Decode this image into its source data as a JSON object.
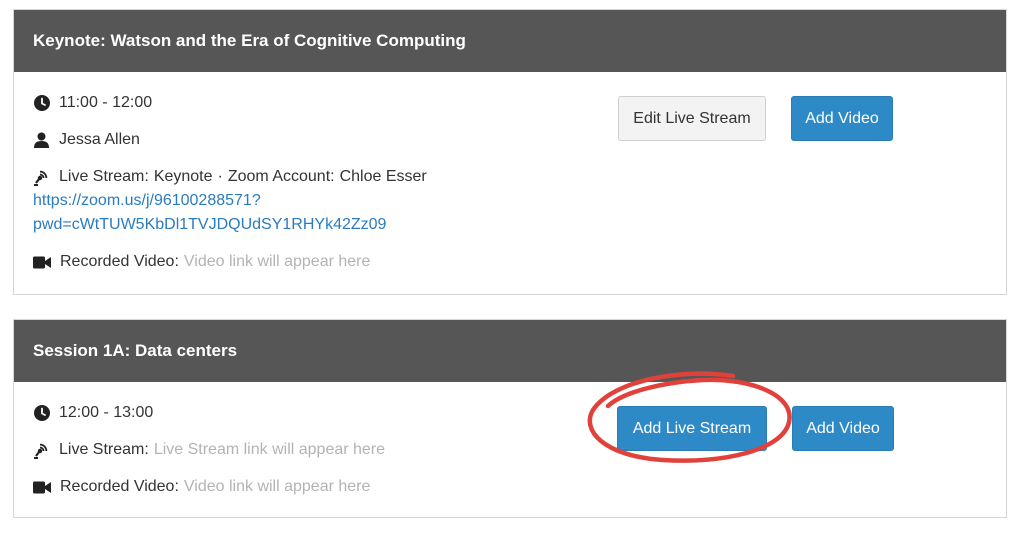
{
  "sessions": [
    {
      "title": "Keynote: Watson and the Era of Cognitive Computing",
      "time": "11:00 - 12:00",
      "speaker": "Jessa Allen",
      "live_stream_label": "Live Stream:",
      "live_stream_name": "Keynote",
      "separator": "·",
      "zoom_account_label": "Zoom Account:",
      "zoom_account_name": "Chloe Esser",
      "link_line1": "https://zoom.us/j/96100288571?",
      "link_line2": "pwd=cWtTUW5KbDl1TVJDQUdSY1RHYk42Zz09",
      "recorded_video_label": "Recorded Video:",
      "recorded_video_placeholder": "Video link will appear here",
      "edit_live_stream_button": "Edit Live Stream",
      "add_video_button": "Add Video"
    },
    {
      "title": "Session 1A: Data centers",
      "time": "12:00 - 13:00",
      "live_stream_label": "Live Stream:",
      "live_stream_placeholder": "Live Stream link will appear here",
      "recorded_video_label": "Recorded Video:",
      "recorded_video_placeholder": "Video link will appear here",
      "add_live_stream_button": "Add Live Stream",
      "add_video_button": "Add Video"
    }
  ],
  "colors": {
    "header_bg": "#565656",
    "primary_button": "#2e8ac6",
    "link": "#2a7bbf",
    "annotation": "#e0413b"
  },
  "icons": [
    "clock-icon",
    "user-icon",
    "broadcast-icon",
    "video-camera-icon"
  ]
}
